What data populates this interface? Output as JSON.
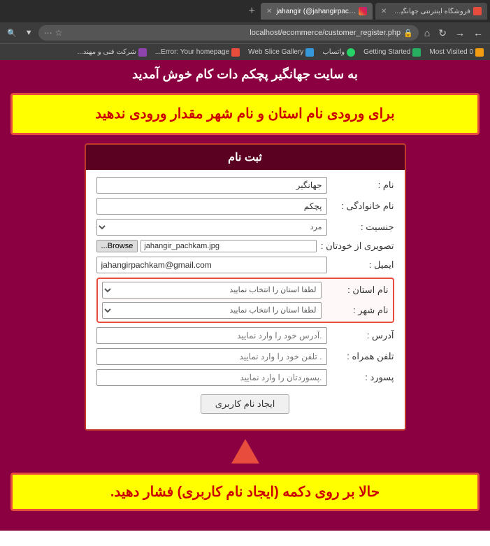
{
  "browser": {
    "tabs": [
      {
        "id": 1,
        "label": "فروشگاه اینترنتی جهانگیر پچکم",
        "active": false,
        "favicon_type": "red"
      },
      {
        "id": 2,
        "label": "jahangir (@jahangirpachkam) • Ins...",
        "active": true,
        "favicon_type": "instagram"
      },
      {
        "id": 3,
        "label": "+",
        "is_add": true
      }
    ],
    "address": "localhost/ecommerce/customer_register.php",
    "bookmarks": [
      {
        "label": "0 Most Visited",
        "favicon_type": "star"
      },
      {
        "label": "Getting Started",
        "favicon_type": "green"
      },
      {
        "label": "واتساب",
        "favicon_type": "whatsapp"
      },
      {
        "label": "Web Slice Gallery",
        "favicon_type": "web"
      },
      {
        "label": "Error: Your homepage...",
        "favicon_type": "red"
      },
      {
        "label": "شرکت فنی و مهند...",
        "favicon_type": "purple"
      }
    ]
  },
  "page": {
    "welcome_text": "به سایت جهانگیر پچکم دات کام خوش آمدید",
    "warning_text": "برای ورودی نام استان و نام شهر مقدار ورودی ندهید",
    "form_title": "ثبت نام",
    "fields": {
      "name_label": "نام :",
      "name_value": "جهانگیر",
      "lastname_label": "نام خانوادگی :",
      "lastname_value": "پچکم",
      "gender_label": "جنسیت :",
      "gender_value": "مرد",
      "photo_label": "تصویری از خودتان :",
      "photo_filename": "jahangir_pachkam.jpg",
      "browse_label": "Browse...",
      "email_label": "ایمیل :",
      "email_value": "jahangirpachkam@gmail.com",
      "province_label": "نام استان :",
      "province_placeholder": "لطفا استان را انتخاب نمایید",
      "city_label": "نام شهر :",
      "city_placeholder": "لطفا استان را انتخاب نمایید",
      "address_label": "آدرس :",
      "address_placeholder": "آدرس خود را وارد نمایید.",
      "phone_label": "تلفن همراه :",
      "phone_placeholder": "تلفن خود را وارد نمایید .",
      "password_label": "پسورد :",
      "password_placeholder": "پسوردتان را وارد نمایید."
    },
    "submit_label": "ایجاد نام کاربری",
    "bottom_text": "حالا بر روی دکمه (ایجاد نام کاربری) فشار دهید."
  }
}
